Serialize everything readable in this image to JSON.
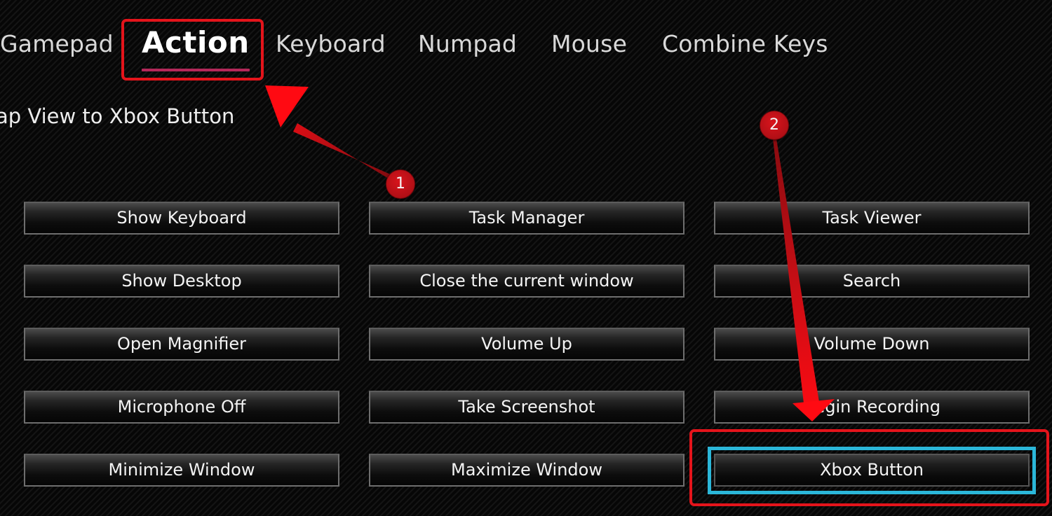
{
  "tabs": [
    {
      "label": "Gamepad",
      "active": false
    },
    {
      "label": "Action",
      "active": true
    },
    {
      "label": "Keyboard",
      "active": false
    },
    {
      "label": "Numpad",
      "active": false
    },
    {
      "label": "Mouse",
      "active": false
    },
    {
      "label": "Combine Keys",
      "active": false
    }
  ],
  "subtitle": "ap View to Xbox Button",
  "actions": [
    [
      "Show Keyboard",
      "Task Manager",
      "Task Viewer"
    ],
    [
      "Show Desktop",
      "Close the current window",
      "Search"
    ],
    [
      "Open Magnifier",
      "Volume Up",
      "Volume Down"
    ],
    [
      "Microphone Off",
      "Take Screenshot",
      "Begin Recording"
    ],
    [
      "Minimize Window",
      "Maximize Window",
      "Xbox Button"
    ]
  ],
  "focused_action": "Xbox Button",
  "annotations": {
    "step1": "1",
    "step2": "2"
  },
  "colors": {
    "tab_underline": "#b4285a",
    "focus_ring": "#2bb7d9",
    "annotation_red": "#e4141b"
  }
}
